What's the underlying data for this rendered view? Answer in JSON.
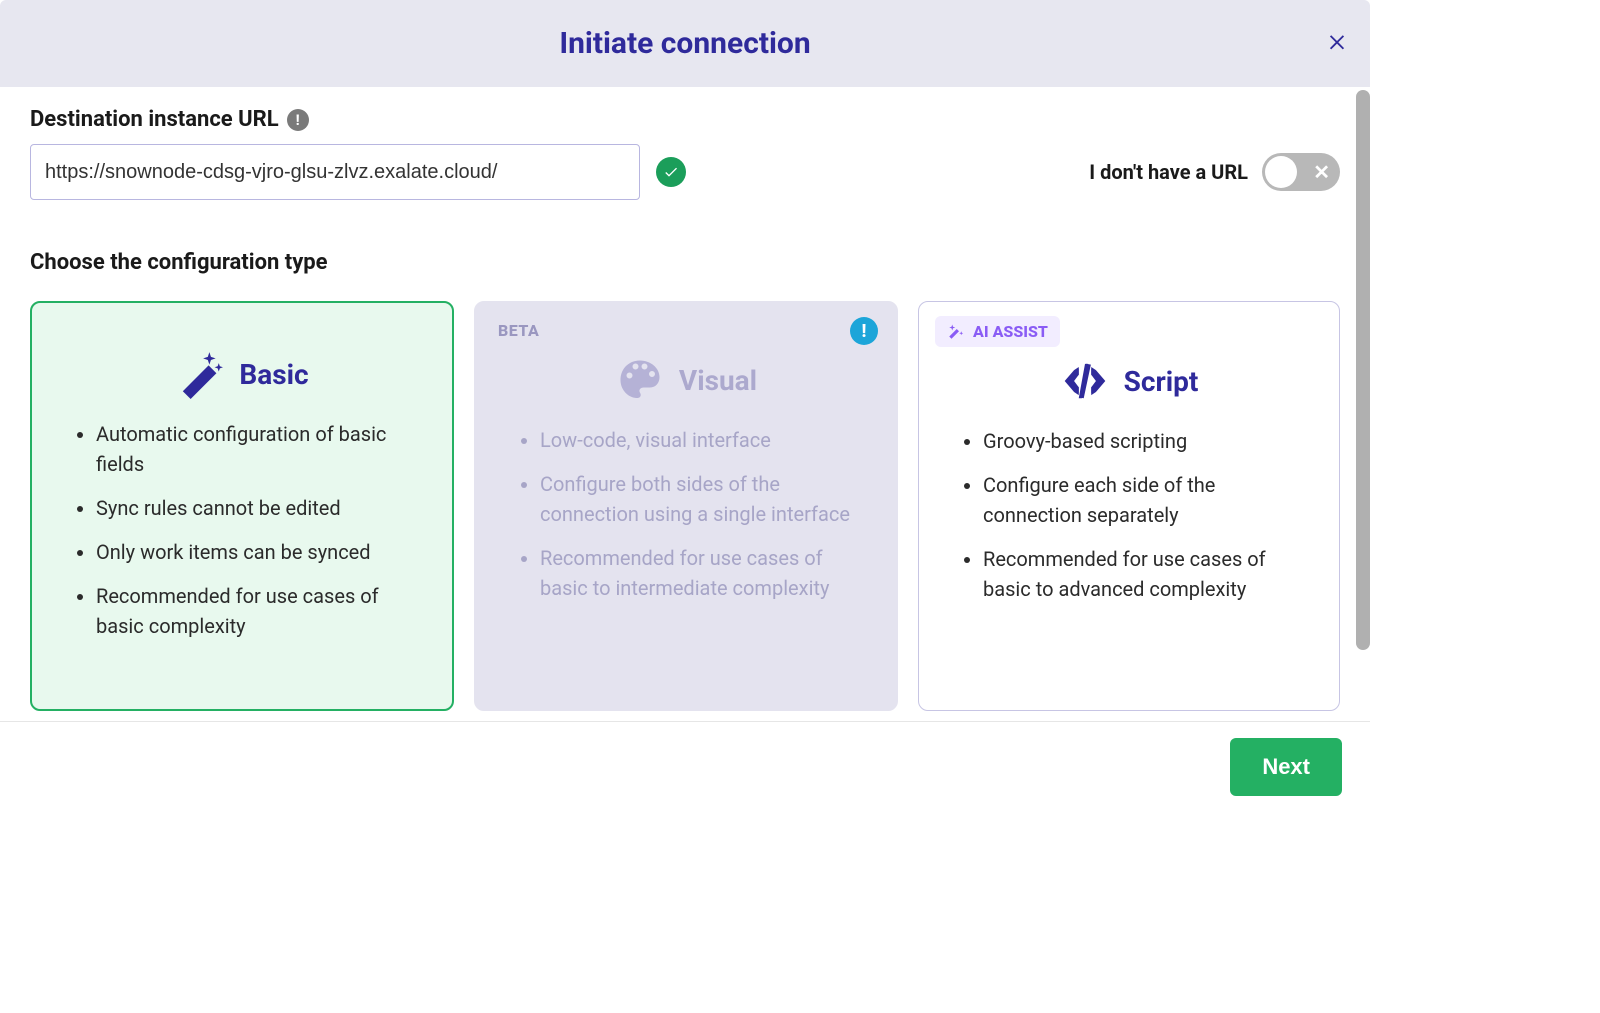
{
  "header": {
    "title": "Initiate connection"
  },
  "destination": {
    "label": "Destination instance URL",
    "value": "https://snownode-cdsg-vjro-glsu-zlvz.exalate.cloud/"
  },
  "no_url": {
    "label": "I don't have a URL",
    "enabled": false
  },
  "config": {
    "section_title": "Choose the configuration type"
  },
  "cards": {
    "basic": {
      "title": "Basic",
      "selected": true,
      "bullets": [
        "Automatic configuration of basic fields",
        "Sync rules cannot be edited",
        "Only work items can be synced",
        "Recommended for use cases of basic complexity"
      ]
    },
    "visual": {
      "title": "Visual",
      "beta_label": "BETA",
      "bullets": [
        "Low-code, visual interface",
        "Configure both sides of the connection using a single interface",
        "Recommended for use cases of basic to intermediate complexity"
      ]
    },
    "script": {
      "title": "Script",
      "ai_label": "AI ASSIST",
      "bullets": [
        "Groovy-based scripting",
        "Configure each side of the connection separately",
        "Recommended for use cases of basic to advanced complexity"
      ]
    }
  },
  "footer": {
    "next_label": "Next"
  }
}
